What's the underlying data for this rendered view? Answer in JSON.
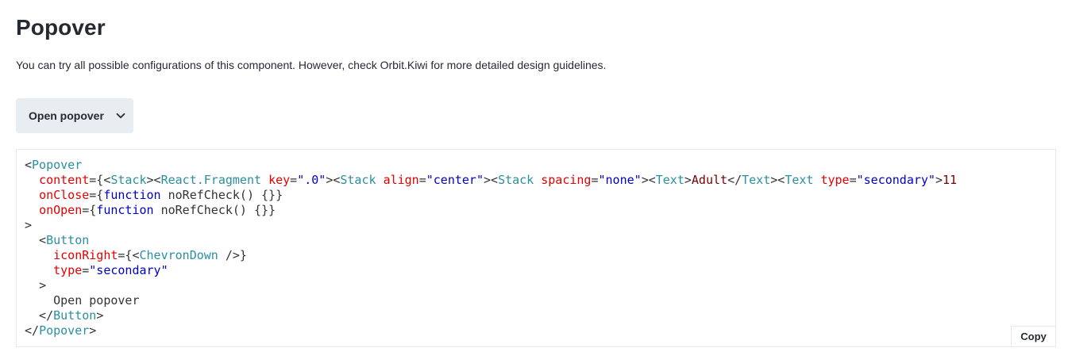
{
  "page": {
    "title": "Popover",
    "description": "You can try all possible configurations of this component. However, check Orbit.Kiwi for more detailed design guidelines."
  },
  "button": {
    "label": "Open popover",
    "icon": "chevron-down-icon"
  },
  "code": {
    "copy_label": "Copy",
    "l1_tag": "Popover",
    "l2_attr": "content",
    "l2_stack": "Stack",
    "l2_fragment": "React.Fragment",
    "l2_key_attr": "key",
    "l2_key_val": "\".0\"",
    "l2_stack2": "Stack",
    "l2_align_attr": "align",
    "l2_align_val": "\"center\"",
    "l2_stack3": "Stack",
    "l2_spacing_attr": "spacing",
    "l2_spacing_val": "\"none\"",
    "l2_text1": "Text",
    "l2_adult": "Adult",
    "l2_text_close": "Text",
    "l2_text2": "Text",
    "l2_type_attr": "type",
    "l2_type_val": "\"secondary\"",
    "l2_tail": "11",
    "l3_attr": "onClose",
    "l3_fn": "function",
    "l3_rest": " noRefCheck() {}}",
    "l4_attr": "onOpen",
    "l4_fn": "function",
    "l4_rest": " noRefCheck() {}}",
    "l5": ">",
    "l6_tag": "Button",
    "l7_attr": "iconRight",
    "l7_tag": "ChevronDown",
    "l8_attr": "type",
    "l8_val": "\"secondary\"",
    "l9": ">",
    "l10_text": "Open popover",
    "l11_tag": "Button",
    "l12_tag": "Popover"
  }
}
